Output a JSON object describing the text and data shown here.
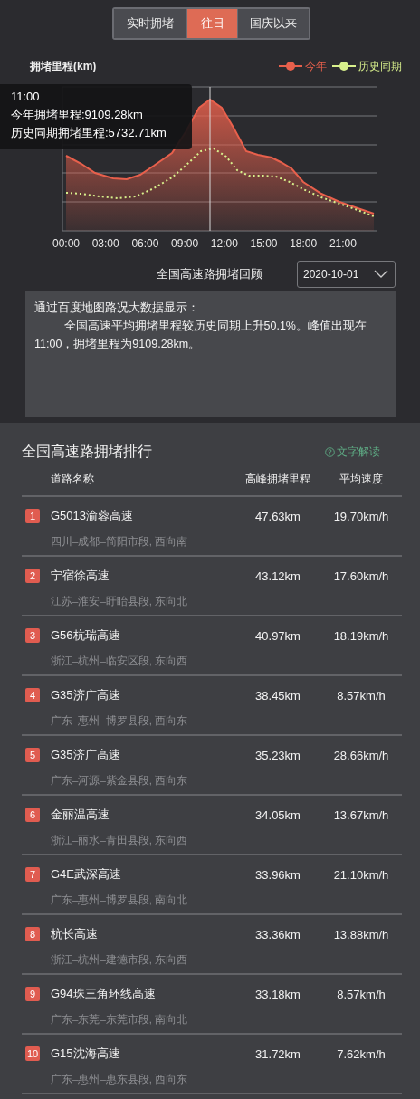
{
  "tabs": [
    {
      "label": "实时拥堵",
      "selected": false
    },
    {
      "label": "往日",
      "selected": true
    },
    {
      "label": "国庆以来",
      "selected": false
    }
  ],
  "chart": {
    "ylabel": "拥堵里程(km)",
    "legend": [
      {
        "label": "今年",
        "color": "#e8604c"
      },
      {
        "label": "历史同期",
        "color": "#d8f08c"
      }
    ],
    "xticks": [
      "00:00",
      "03:00",
      "06:00",
      "09:00",
      "12:00",
      "15:00",
      "18:00",
      "21:00"
    ],
    "tooltip": [
      "11:00",
      "今年拥堵里程:9109.28km",
      "历史同期拥堵里程:5732.71km"
    ]
  },
  "review": {
    "label": "全国高速路拥堵回顾",
    "date": "2020-10-01"
  },
  "summary": {
    "heading": "通过百度地图路况大数据显示：",
    "body": "全国高速平均拥堵里程较历史同期上升50.1%。峰值出现在11:00，拥堵里程为9109.28km。"
  },
  "ranking": {
    "title": "全国高速路拥堵排行",
    "help": "文字解读",
    "columns": [
      "道路名称",
      "高峰拥堵里程",
      "平均速度"
    ],
    "rows": [
      {
        "rank": "1",
        "name": "G5013渝蓉高速",
        "section": "四川–成都–简阳市段, 西向南",
        "length": "47.63km",
        "speed": "19.70km/h"
      },
      {
        "rank": "2",
        "name": "宁宿徐高速",
        "section": "江苏–淮安–盱眙县段, 东向北",
        "length": "43.12km",
        "speed": "17.60km/h"
      },
      {
        "rank": "3",
        "name": "G56杭瑞高速",
        "section": "浙江–杭州–临安区段, 东向西",
        "length": "40.97km",
        "speed": "18.19km/h"
      },
      {
        "rank": "4",
        "name": "G35济广高速",
        "section": "广东–惠州–博罗县段, 西向东",
        "length": "38.45km",
        "speed": "8.57km/h"
      },
      {
        "rank": "5",
        "name": "G35济广高速",
        "section": "广东–河源–紫金县段, 西向东",
        "length": "35.23km",
        "speed": "28.66km/h"
      },
      {
        "rank": "6",
        "name": "金丽温高速",
        "section": "浙江–丽水–青田县段, 东向西",
        "length": "34.05km",
        "speed": "13.67km/h"
      },
      {
        "rank": "7",
        "name": "G4E武深高速",
        "section": "广东–惠州–博罗县段, 南向北",
        "length": "33.96km",
        "speed": "21.10km/h"
      },
      {
        "rank": "8",
        "name": "杭长高速",
        "section": "浙江–杭州–建德市段, 东向西",
        "length": "33.36km",
        "speed": "13.88km/h"
      },
      {
        "rank": "9",
        "name": "G94珠三角环线高速",
        "section": "广东–东莞–东莞市段, 南向北",
        "length": "33.18km",
        "speed": "8.57km/h"
      },
      {
        "rank": "10",
        "name": "G15沈海高速",
        "section": "广东–惠州–惠东县段, 西向东",
        "length": "31.72km",
        "speed": "7.62km/h"
      }
    ]
  }
}
